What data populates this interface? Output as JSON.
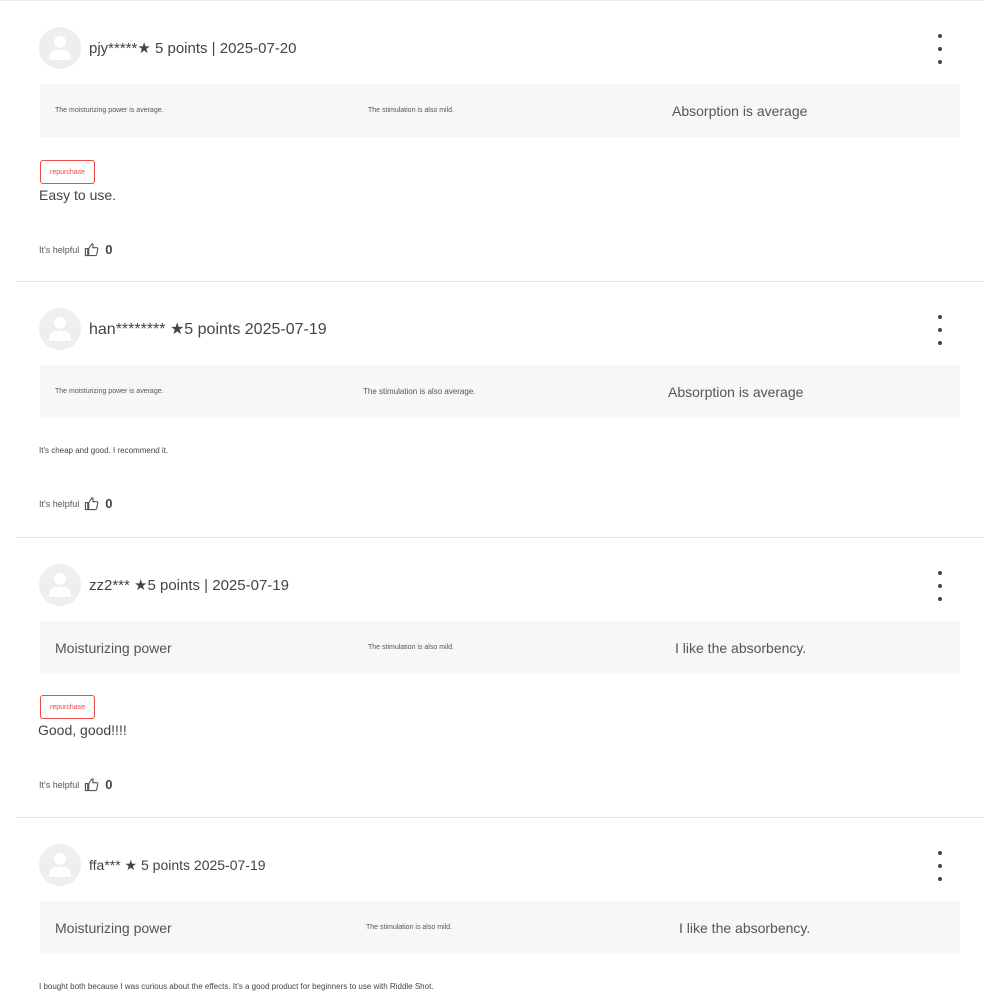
{
  "reviews": [
    {
      "username": "pjy*****★ 5 points | 2025-07-20",
      "attributes": [
        "The moisturizing power is average.",
        "The stimulation is also mild.",
        "Absorption is average"
      ],
      "badge": "repurchase",
      "text": "Easy to use.",
      "helpful_label": "It's helpful",
      "helpful_count": "0"
    },
    {
      "username": "han******** ★5 points 2025-07-19",
      "attributes": [
        "The moisturizing power is average.",
        "The stimulation is also average.",
        "Absorption is average"
      ],
      "badge": "",
      "text": "It's cheap and good. I recommend it.",
      "helpful_label": "It's helpful",
      "helpful_count": "0"
    },
    {
      "username": "zz2*** ★5 points | 2025-07-19",
      "attributes": [
        "Moisturizing power",
        "The stimulation is also mild.",
        "I like the absorbency."
      ],
      "badge": "repurchase",
      "text": "Good, good!!!!",
      "helpful_label": "It's helpful",
      "helpful_count": "0"
    },
    {
      "username": "ffa*** ★ 5 points 2025-07-19",
      "attributes": [
        "Moisturizing power",
        "The stimulation is also mild.",
        "I like the absorbency."
      ],
      "badge": "",
      "text": "I bought both because I was curious about the effects. It's a good product for beginners to use with Riddle Shot.",
      "helpful_label": "",
      "helpful_count": ""
    }
  ]
}
